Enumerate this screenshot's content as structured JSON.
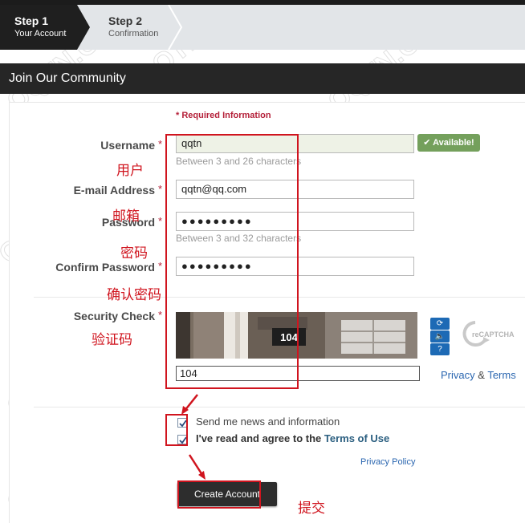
{
  "steps": [
    {
      "title": "Step 1",
      "subtitle": "Your Account"
    },
    {
      "title": "Step 2",
      "subtitle": "Confirmation"
    }
  ],
  "header": {
    "title": "Join Our Community"
  },
  "form": {
    "required_note": "* Required Information",
    "required_mark": "*",
    "username": {
      "label": "Username",
      "value": "qqtn",
      "hint": "Between 3 and 26 characters",
      "status": "✔ Available!"
    },
    "email": {
      "label": "E-mail Address",
      "value": "qqtn@qq.com"
    },
    "password": {
      "label": "Password",
      "value": "●●●●●●●●●",
      "hint": "Between 3 and 32 characters"
    },
    "confirm_password": {
      "label": "Confirm Password",
      "value": "●●●●●●●●●"
    },
    "security": {
      "label": "Security Check",
      "captcha_text": "104",
      "value": "104",
      "recaptcha_label": "reCAPTCHA"
    },
    "privacy_link": "Privacy",
    "terms_link": "Terms",
    "amp": "&",
    "news_checkbox": {
      "label": "Send me news and information",
      "checked": true
    },
    "terms_checkbox": {
      "label": "I've read and agree to the ",
      "link": "Terms of Use",
      "checked": true
    },
    "privacy_policy": "Privacy Policy",
    "submit": "Create Account"
  },
  "annotations": {
    "username": "用户",
    "email": "邮箱",
    "password": "密码",
    "confirm": "确认密码",
    "captcha": "验证码",
    "submit": "提交"
  },
  "watermark": "QQTN.COM",
  "colors": {
    "accent_red": "#d0141e",
    "available_green": "#74a05c",
    "link_blue": "#2a66b0",
    "header_dark": "#262626"
  }
}
